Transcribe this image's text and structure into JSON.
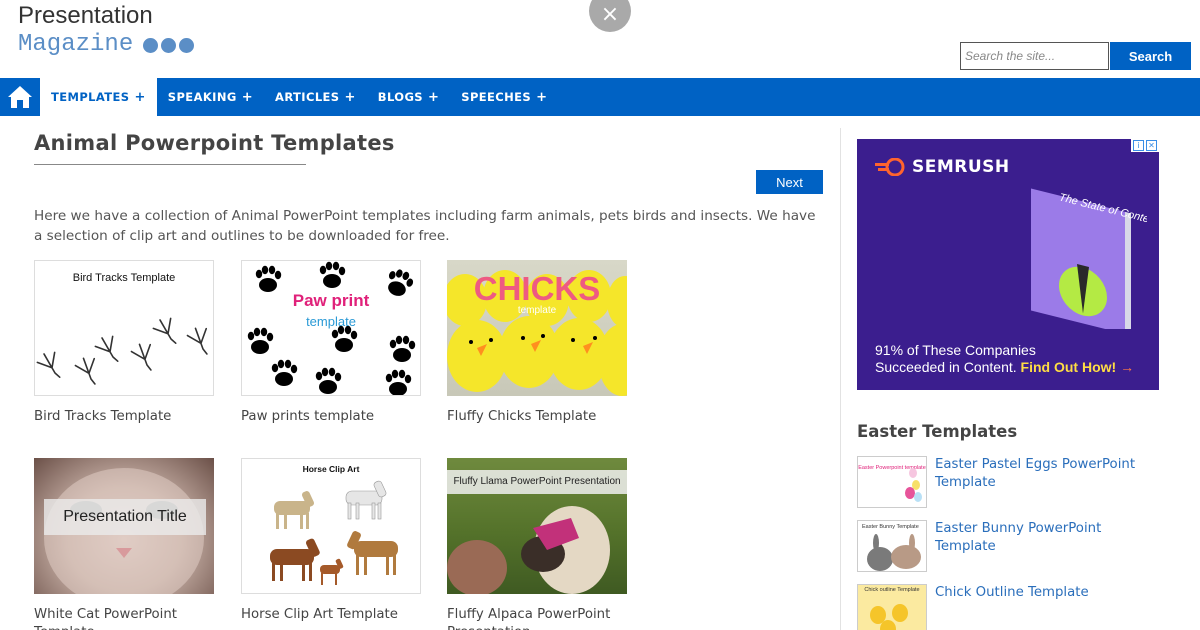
{
  "header": {
    "logo_line1": "Presentation",
    "logo_line2": "Magazine",
    "search_placeholder": "Search the site...",
    "search_button": "Search",
    "close_label": "×"
  },
  "nav": {
    "items": [
      {
        "label": "TEMPLATES",
        "plus": "+"
      },
      {
        "label": "SPEAKING",
        "plus": "+"
      },
      {
        "label": "ARTICLES",
        "plus": "+"
      },
      {
        "label": "BLOGS",
        "plus": "+"
      },
      {
        "label": "SPEECHES",
        "plus": "+"
      }
    ],
    "active_index": 0,
    "home_icon": "home-icon"
  },
  "main": {
    "title": "Animal Powerpoint Templates",
    "next_button": "Next",
    "intro": "Here we have a collection of Animal PowerPoint templates including farm animals, pets birds and insects. We have a selection of clip art and outlines to be downloaded for free.",
    "cards": [
      {
        "caption": "Bird Tracks Template",
        "thumb_title": "Bird Tracks Template"
      },
      {
        "caption": "Paw prints template",
        "thumb_title": "Paw print",
        "thumb_sub": "template"
      },
      {
        "caption": "Fluffy Chicks Template",
        "thumb_title": "CHICKS",
        "thumb_sub": "template"
      },
      {
        "caption": "White Cat PowerPoint Template",
        "thumb_title": "Presentation Title"
      },
      {
        "caption": "Horse Clip Art Template",
        "thumb_title": "Horse Clip Art"
      },
      {
        "caption": "Fluffy Alpaca PowerPoint Presentation",
        "thumb_title": "Fluffy Llama PowerPoint Presentation"
      }
    ]
  },
  "sidebar": {
    "ad": {
      "brand": "SEMRUSH",
      "book_title": "The State of Content Marketing",
      "text_line1": "91% of These Companies",
      "text_line2": "Succeeded in Content.",
      "cta": "Find Out How!",
      "cta_arrow": "→",
      "bg_color": "#3b1e8e"
    },
    "heading": "Easter Templates",
    "items": [
      {
        "label": "Easter Pastel Eggs PowerPoint Template",
        "thumb_title": "Easter Powerpoint template"
      },
      {
        "label": "Easter Bunny PowerPoint Template",
        "thumb_title": "Easter Bunny Template"
      },
      {
        "label": "Chick Outline Template",
        "thumb_title": "Chick outline Template"
      }
    ]
  },
  "colors": {
    "brand_blue": "#0062c4",
    "link_blue": "#2a6ebb",
    "logo_blue": "#5b8ec6"
  }
}
